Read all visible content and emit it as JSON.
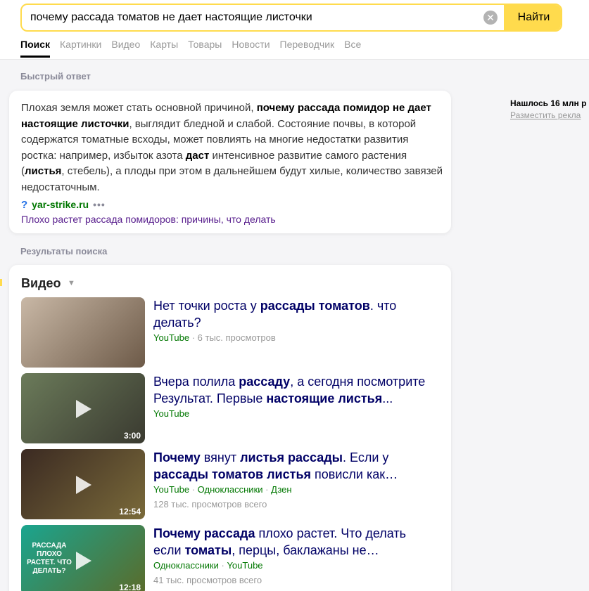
{
  "search": {
    "query": "почему рассада томатов не дает настоящие листочки",
    "clear_icon": "clear-icon",
    "submit_label": "Найти"
  },
  "tabs": [
    {
      "label": "Поиск",
      "active": true
    },
    {
      "label": "Картинки"
    },
    {
      "label": "Видео"
    },
    {
      "label": "Карты"
    },
    {
      "label": "Товары"
    },
    {
      "label": "Новости"
    },
    {
      "label": "Переводчик"
    },
    {
      "label": "Все"
    }
  ],
  "quick_answer": {
    "section_label": "Быстрый ответ",
    "text_parts": [
      {
        "t": "Плохая земля может стать основной причиной, ",
        "b": false
      },
      {
        "t": "почему рассада помидор не дает настоящие листочки",
        "b": true
      },
      {
        "t": ", выглядит бледной и слабой. Состояние почвы, в которой содержатся томатные всходы, может повлиять на многие недостатки развития ростка: например, избыток азота ",
        "b": false
      },
      {
        "t": "даст",
        "b": true
      },
      {
        "t": " интенсивное развитие самого растения (",
        "b": false
      },
      {
        "t": "листья",
        "b": true
      },
      {
        "t": ", стебель), а плоды при этом в дальнейшем будут хилые, количество завязей недостаточным.",
        "b": false
      }
    ],
    "source_icon": "question-icon",
    "source_domain": "yar-strike.ru",
    "more_label": "•••",
    "source_title": "Плохо растет рассада помидоров: причины, что делать"
  },
  "sidebar": {
    "found_text": "Нашлось 16 млн р",
    "ad_link": "Разместить рекла"
  },
  "results": {
    "section_label": "Результаты поиска",
    "video_heading": "Видео",
    "videos": [
      {
        "title_parts": [
          {
            "t": "Нет точки роста у ",
            "b": false
          },
          {
            "t": "рассады томатов",
            "b": true
          },
          {
            "t": ". что делать?",
            "b": false
          }
        ],
        "hosts": [
          "YouTube"
        ],
        "views": "6 тыс. просмотров",
        "duration": "",
        "thumb_colors": [
          "#c9b8a6",
          "#6d5a48"
        ]
      },
      {
        "title_parts": [
          {
            "t": "Вчера полила ",
            "b": false
          },
          {
            "t": "рассаду",
            "b": true
          },
          {
            "t": ", а сегодня посмотрите Результат. Первые ",
            "b": false
          },
          {
            "t": "настоящие листья",
            "b": true
          },
          {
            "t": "...",
            "b": false
          }
        ],
        "hosts": [
          "YouTube"
        ],
        "views": "",
        "duration": "3:00",
        "thumb_colors": [
          "#6b7b5a",
          "#3a3a30"
        ]
      },
      {
        "title_parts": [
          {
            "t": "Почему",
            "b": true
          },
          {
            "t": " вянут ",
            "b": false
          },
          {
            "t": "листья рассады",
            "b": true
          },
          {
            "t": ". Если у ",
            "b": false
          },
          {
            "t": "рассады томатов листья",
            "b": true
          },
          {
            "t": " повисли как…",
            "b": false
          }
        ],
        "hosts": [
          "YouTube",
          "Одноклассники",
          "Дзен"
        ],
        "views": "128 тыс. просмотров всего",
        "duration": "12:54",
        "thumb_colors": [
          "#3b2a22",
          "#7a6a3a"
        ]
      },
      {
        "title_parts": [
          {
            "t": "Почему рассада",
            "b": true
          },
          {
            "t": " плохо растет. Что делать если ",
            "b": false
          },
          {
            "t": "томаты",
            "b": true
          },
          {
            "t": ", перцы, баклажаны не…",
            "b": false
          }
        ],
        "hosts": [
          "Одноклассники",
          "YouTube"
        ],
        "views": "41 тыс. просмотров всего",
        "duration": "12:18",
        "thumb_colors": [
          "#1aa58f",
          "#5b6b2a"
        ],
        "thumb_text": "РАССАДА ПЛОХО РАСТЕТ. ЧТО ДЕЛАТЬ?"
      }
    ]
  }
}
